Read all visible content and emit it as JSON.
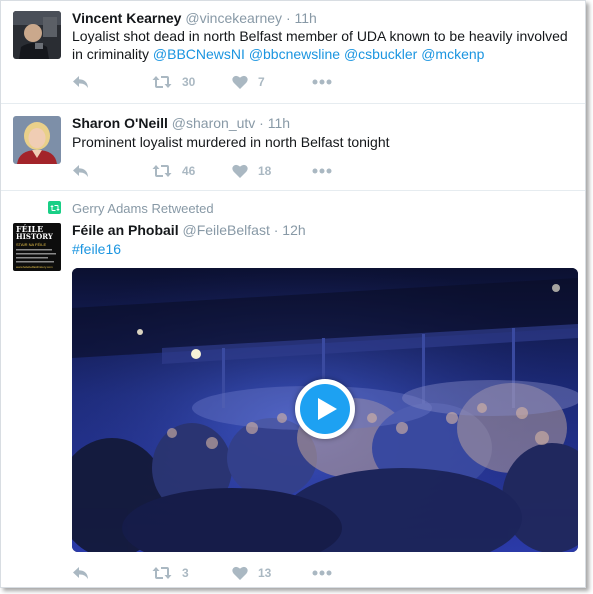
{
  "tweets": [
    {
      "name": "Vincent Kearney",
      "handle": "@vincekearney",
      "dot": "·",
      "time": "11h",
      "text_line1": "Loyalist shot dead in north Belfast member of UDA known to be heavily involved",
      "text_line2_prefix": "in criminality ",
      "mentions": [
        "@BBCNewsNI",
        "@bbcnewsline",
        "@csbuckler",
        "@mckenp"
      ],
      "retweets": "30",
      "likes": "7"
    },
    {
      "name": "Sharon O'Neill",
      "handle": "@sharon_utv",
      "dot": "·",
      "time": "11h",
      "text": "Prominent loyalist murdered in north Belfast tonight",
      "retweets": "46",
      "likes": "18"
    },
    {
      "retweeted_by": "Gerry Adams Retweeted",
      "name": "Féile an Phobail",
      "handle": "@FeileBelfast",
      "dot": "·",
      "time": "12h",
      "hashtag": "#feile16",
      "avatar_text": {
        "line1": "FÉILE",
        "line2": "HISTORY",
        "line3": "STAIR NA FÉILE",
        "url": "www.feilebelfasthistory.com"
      },
      "retweets": "3",
      "likes": "13"
    }
  ],
  "icons": {
    "reply": "reply-icon",
    "retweet": "retweet-icon",
    "like": "heart-icon",
    "more": "more-icon",
    "play": "play-icon"
  },
  "colors": {
    "link": "#1b95e0",
    "meta": "#8899a6",
    "action": "#aab8c2",
    "retweet_badge": "#19cf86",
    "play": "#1da1f2"
  }
}
